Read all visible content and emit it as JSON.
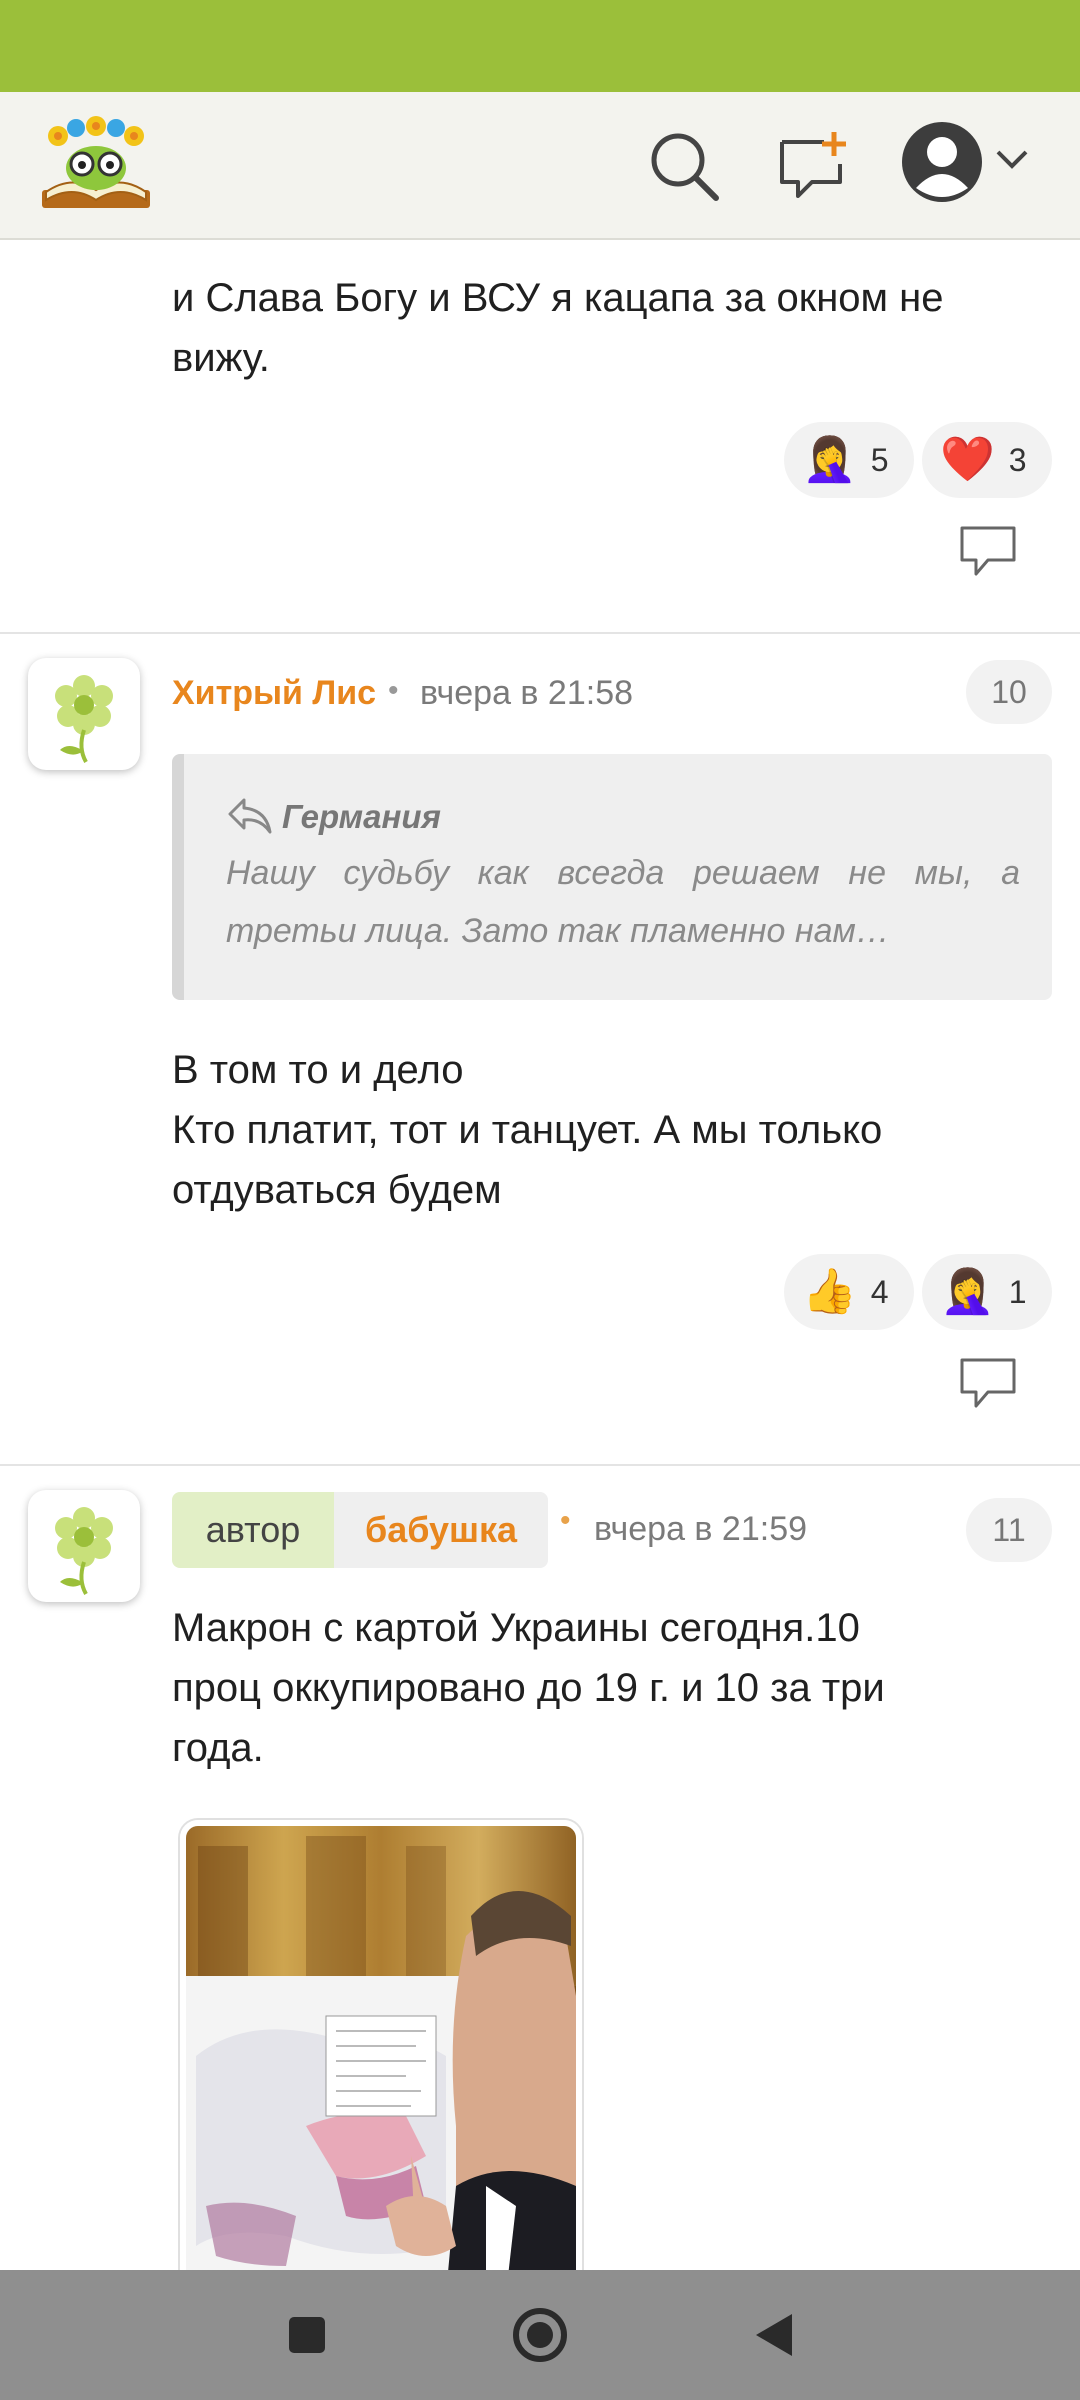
{
  "colors": {
    "status_bar": "#9bbf3a",
    "accent": "#e8861d",
    "header_bg": "#f3f3ee",
    "nav_bar": "#8f8f8f"
  },
  "header": {
    "logo": "book-flower-logo",
    "icons": [
      "search-icon",
      "new-message-icon",
      "account-icon",
      "chevron-down-icon"
    ]
  },
  "comments": [
    {
      "text_lines": [
        "и Слава Богу и ВСУ я кацапа за окном не",
        "вижу."
      ],
      "reactions": [
        {
          "icon": "facepalm-emoji",
          "emoji": "🤦‍♀️",
          "count": "5"
        },
        {
          "icon": "heart-emoji",
          "emoji": "❤️",
          "count": "3"
        }
      ]
    },
    {
      "author": "Хитрый Лис",
      "time": "вчера в 21:58",
      "number": "10",
      "quote": {
        "title": "Германия",
        "text": "Нашу судьбу как всегда решаем не мы, а третьи лица. Зато так пламенно нам…"
      },
      "text_lines": [
        "В том то и дело",
        "Кто платит, тот и танцует. А мы только",
        "отдуваться будем"
      ],
      "reactions": [
        {
          "icon": "thumbs-up-emoji",
          "emoji": "👍",
          "count": "4"
        },
        {
          "icon": "facepalm-emoji",
          "emoji": "🤦‍♀️",
          "count": "1"
        }
      ]
    },
    {
      "tag_label": "автор",
      "author": "бабушка",
      "time": "вчера в 21:59",
      "number": "11",
      "text_lines": [
        "Макрон с картой Украины сегодня.10",
        "проц оккупировано до 19 г. и 10 за три",
        "года."
      ],
      "image": "photo-man-with-map"
    }
  ],
  "nav": {
    "icons": [
      "recent-apps-icon",
      "home-icon",
      "back-icon"
    ]
  }
}
